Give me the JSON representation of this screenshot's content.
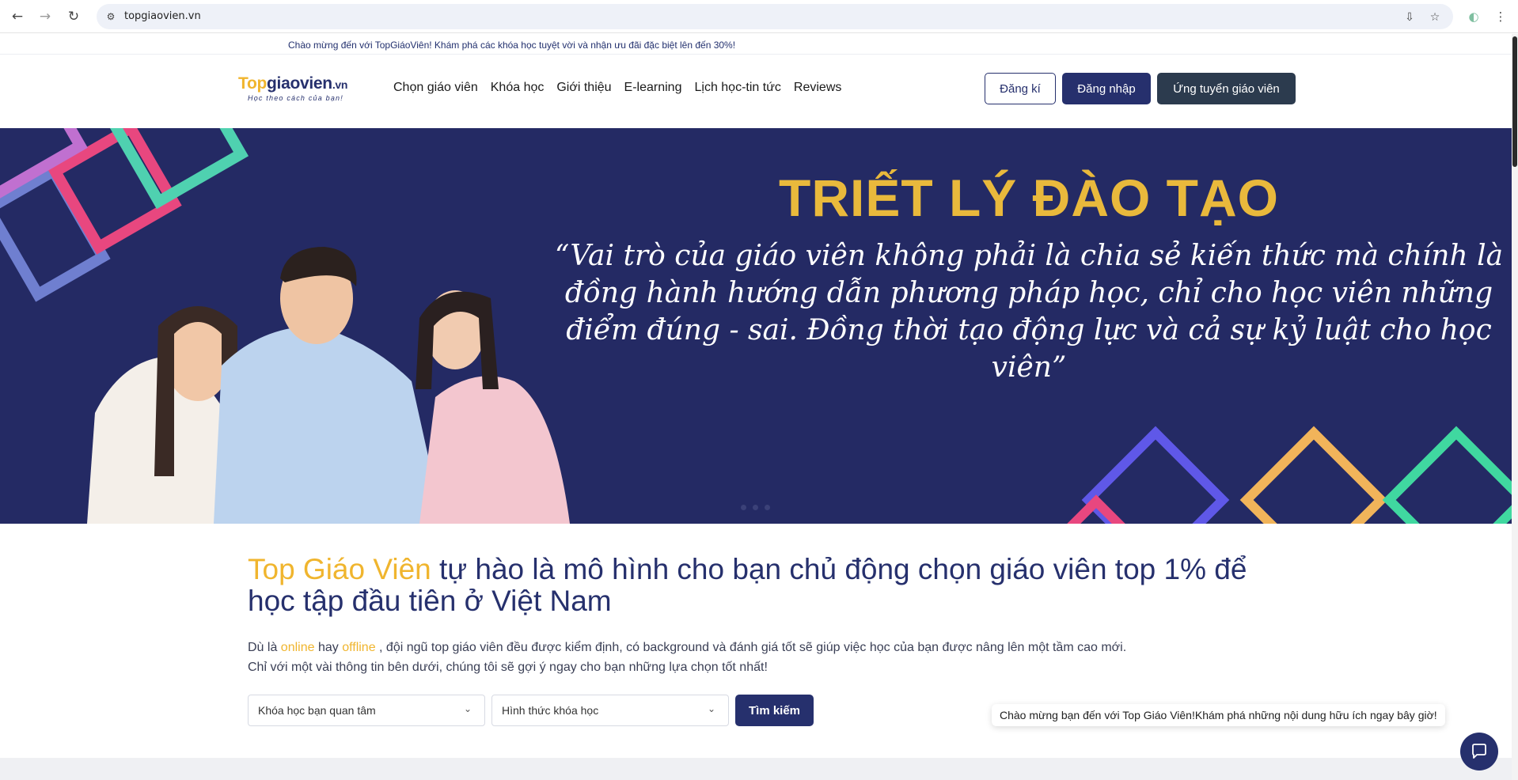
{
  "browser": {
    "url": "topgiaovien.vn",
    "back_icon": "←",
    "forward_icon": "→",
    "reload_icon": "↻",
    "site_info_icon": "⚙",
    "install_icon": "⇩",
    "bookmark_icon": "☆",
    "profile_icon": "◐",
    "menu_icon": "⋮"
  },
  "announcement": "Chào mừng đến với TopGiáoViên! Khám phá các khóa học tuyệt vời và nhận ưu đãi đặc biệt lên đến 30%!",
  "header": {
    "logo": {
      "top": "Top",
      "main": "giaovien",
      "tld": ".vn",
      "tagline": "Học theo cách của bạn!"
    },
    "menu": [
      "Chọn giáo viên",
      "Khóa học",
      "Giới thiệu",
      "E-learning",
      "Lịch học-tin tức",
      "Reviews"
    ],
    "register_label": "Đăng kí",
    "login_label": "Đăng nhập",
    "apply_label": "Ứng tuyển giáo viên"
  },
  "hero": {
    "title": "TRIẾT LÝ ĐÀO TẠO",
    "quote": "“Vai trò của giáo viên không phải là chia sẻ kiến thức mà chính là đồng hành hướng dẫn phương pháp học, chỉ cho học viên những điểm đúng - sai. Đồng thời tạo động lực và cả sự kỷ luật cho học viên”",
    "colors": {
      "background": "#242a64",
      "title": "#e9b93c"
    }
  },
  "intro": {
    "brand": "Top Giáo Viên",
    "headline_rest": " tự hào là mô hình cho bạn chủ động chọn giáo viên top 1% để học tập đầu tiên ở Việt Nam",
    "desc_prefix": "Dù là ",
    "desc_online": "online",
    "desc_mid": " hay ",
    "desc_offline": "offline",
    "desc_rest": " , đội ngũ top giáo viên đều được kiểm định, có background và đánh giá tốt sẽ giúp việc học của bạn được nâng lên một tầm cao mới.",
    "desc_line2": "Chỉ với một vài thông tin bên dưới, chúng tôi sẽ gợi ý ngay cho bạn những lựa chọn tốt nhất!"
  },
  "search": {
    "course_select": "Khóa học bạn quan tâm",
    "format_select": "Hình thức khóa học",
    "button": "Tìm kiếm"
  },
  "chat": {
    "message": "Chào mừng bạn đến với Top Giáo Viên!Khám phá những nội dung hữu ích ngay bây giờ!",
    "icon": "chat-icon"
  },
  "colors": {
    "brand_navy": "#26306d",
    "brand_gold": "#f0b52e"
  }
}
